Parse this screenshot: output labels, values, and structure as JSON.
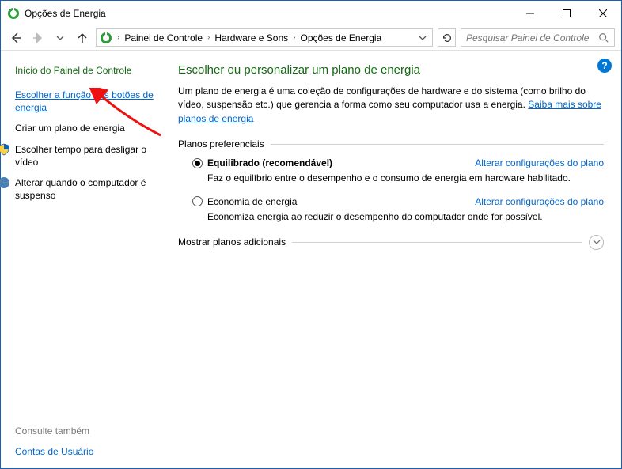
{
  "window": {
    "title": "Opções de Energia"
  },
  "breadcrumb": {
    "root": "Painel de Controle",
    "mid": "Hardware e Sons",
    "leaf": "Opções de Energia"
  },
  "search": {
    "placeholder": "Pesquisar Painel de Controle"
  },
  "sidebar": {
    "home": "Início do Painel de Controle",
    "link_buttons": "Escolher a função dos botões de energia",
    "link_create": "Criar um plano de energia",
    "link_display": "Escolher tempo para desligar o vídeo",
    "link_sleep": "Alterar quando o computador é suspenso",
    "see_also_label": "Consulte também",
    "see_also_link": "Contas de Usuário"
  },
  "main": {
    "heading": "Escolher ou personalizar um plano de energia",
    "intro_pre": "Um plano de energia é uma coleção de configurações de hardware e do sistema (como brilho do vídeo, suspensão etc.) que gerencia a forma como seu computador usa a energia. ",
    "intro_link": "Saiba mais sobre planos de energia",
    "preferred_label": "Planos preferenciais",
    "additional_label": "Mostrar planos adicionais",
    "plans": [
      {
        "name": "Equilibrado (recomendável)",
        "desc": "Faz o equilíbrio entre o desempenho e o consumo de energia em hardware habilitado.",
        "edit": "Alterar configurações do plano",
        "selected": true
      },
      {
        "name": "Economia de energia",
        "desc": "Economiza energia ao reduzir o desempenho do computador onde for possível.",
        "edit": "Alterar configurações do plano",
        "selected": false
      }
    ]
  },
  "help": {
    "symbol": "?"
  }
}
